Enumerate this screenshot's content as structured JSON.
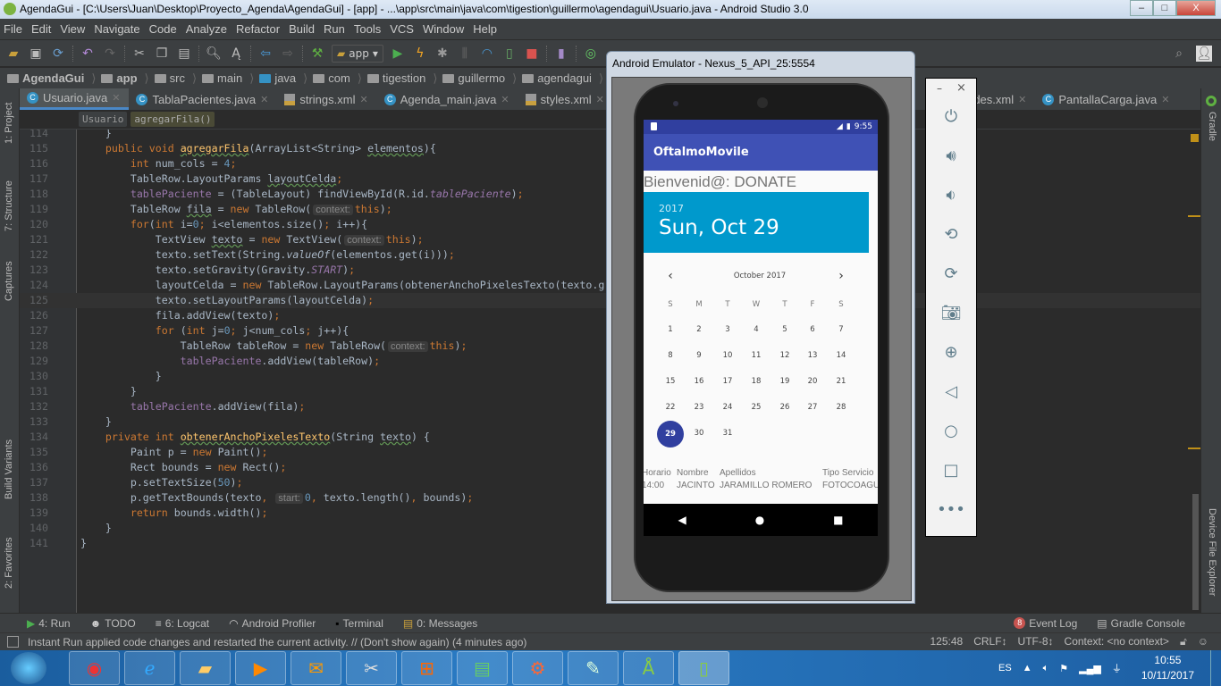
{
  "window": {
    "title": "AgendaGui - [C:\\Users\\Juan\\Desktop\\Proyecto_Agenda\\AgendaGui] - [app] - ...\\app\\src\\main\\java\\com\\tigestion\\guillermo\\agendagui\\Usuario.java - Android Studio 3.0",
    "min": "–",
    "max": "□",
    "close": "X"
  },
  "menu": [
    "File",
    "Edit",
    "View",
    "Navigate",
    "Code",
    "Analyze",
    "Refactor",
    "Build",
    "Run",
    "Tools",
    "VCS",
    "Window",
    "Help"
  ],
  "toolbar": {
    "run_config": "app"
  },
  "breadcrumb": [
    "AgendaGui",
    "app",
    "src",
    "main",
    "java",
    "com",
    "tigestion",
    "guillermo",
    "agendagui",
    "Usuario"
  ],
  "tabs": [
    {
      "label": "Usuario.java",
      "type": "class",
      "active": true
    },
    {
      "label": "TablaPacientes.java",
      "type": "class"
    },
    {
      "label": "strings.xml",
      "type": "xml"
    },
    {
      "label": "Agenda_main.java",
      "type": "class"
    },
    {
      "label": "styles.xml",
      "type": "xml"
    },
    {
      "label": "a",
      "type": "xml"
    }
  ],
  "tabs_right": [
    {
      "label": "rdes.xml",
      "type": "xml"
    },
    {
      "label": "PantallaCarga.java",
      "type": "class"
    }
  ],
  "method_breadcrumb": {
    "class": "Usuario",
    "method": "agregarFila()"
  },
  "left_tools": [
    "1: Project",
    "7: Structure",
    "Captures",
    "Build Variants",
    "2: Favorites"
  ],
  "right_tools": [
    "Gradle",
    "Device File Explorer"
  ],
  "code": [
    {
      "n": 114,
      "t": [
        [
          "p",
          "    }"
        ]
      ]
    },
    {
      "n": 115,
      "t": [
        [
          "p",
          "    "
        ],
        [
          "k",
          "public void "
        ],
        [
          "mw",
          "agregarFila"
        ],
        [
          "p",
          "(ArrayList<String> "
        ],
        [
          "w",
          "elementos"
        ],
        [
          "p",
          "){"
        ]
      ]
    },
    {
      "n": 116,
      "t": [
        [
          "p",
          "        "
        ],
        [
          "k",
          "int "
        ],
        [
          "p",
          "num_cols = "
        ],
        [
          "n",
          "4"
        ],
        [
          "k",
          ";"
        ]
      ]
    },
    {
      "n": 117,
      "t": [
        [
          "p",
          "        TableRow.LayoutParams "
        ],
        [
          "w",
          "layoutCelda"
        ],
        [
          "k",
          ";"
        ]
      ]
    },
    {
      "n": 118,
      "t": [
        [
          "f",
          "        tablePaciente"
        ],
        [
          "p",
          " = (TableLayout) findViewById(R.id."
        ],
        [
          "fi",
          "tablePaciente"
        ],
        [
          "p",
          ")"
        ],
        [
          "k",
          ";"
        ]
      ]
    },
    {
      "n": 119,
      "t": [
        [
          "p",
          "        TableRow "
        ],
        [
          "w",
          "fila"
        ],
        [
          "p",
          " = "
        ],
        [
          "k",
          "new "
        ],
        [
          "p",
          "TableRow("
        ],
        [
          "h",
          "context:"
        ],
        [
          "k",
          "this"
        ],
        [
          "p",
          ")"
        ],
        [
          "k",
          ";"
        ]
      ]
    },
    {
      "n": 120,
      "t": [
        [
          "p",
          "        "
        ],
        [
          "k",
          "for"
        ],
        [
          "p",
          "("
        ],
        [
          "k",
          "int "
        ],
        [
          "p",
          "i="
        ],
        [
          "n",
          "0"
        ],
        [
          "k",
          "; "
        ],
        [
          "p",
          "i<elementos.size()"
        ],
        [
          "k",
          "; "
        ],
        [
          "p",
          "i++){"
        ]
      ]
    },
    {
      "n": 121,
      "t": [
        [
          "p",
          "            TextView "
        ],
        [
          "w",
          "texto"
        ],
        [
          "p",
          " = "
        ],
        [
          "k",
          "new "
        ],
        [
          "p",
          "TextView("
        ],
        [
          "h",
          "context:"
        ],
        [
          "k",
          "this"
        ],
        [
          "p",
          ")"
        ],
        [
          "k",
          ";"
        ]
      ]
    },
    {
      "n": 122,
      "t": [
        [
          "p",
          "            texto.setText(String."
        ],
        [
          "i",
          "valueOf"
        ],
        [
          "p",
          "(elementos.get(i)))"
        ],
        [
          "k",
          ";"
        ]
      ]
    },
    {
      "n": 123,
      "t": [
        [
          "p",
          "            texto.setGravity(Gravity."
        ],
        [
          "fi",
          "START"
        ],
        [
          "p",
          ")"
        ],
        [
          "k",
          ";"
        ]
      ]
    },
    {
      "n": 124,
      "t": [
        [
          "p",
          "            layoutCelda = "
        ],
        [
          "k",
          "new "
        ],
        [
          "p",
          "TableRow.LayoutParams(obtenerAnchoPixelesTexto(texto.g"
        ]
      ]
    },
    {
      "n": 125,
      "t": [
        [
          "p",
          "            texto.setLayoutParams(layoutCelda)"
        ],
        [
          "k",
          ";"
        ]
      ],
      "current": true
    },
    {
      "n": 126,
      "t": [
        [
          "p",
          "            fila.addView(texto)"
        ],
        [
          "k",
          ";"
        ]
      ]
    },
    {
      "n": 127,
      "t": [
        [
          "p",
          "            "
        ],
        [
          "k",
          "for "
        ],
        [
          "p",
          "("
        ],
        [
          "k",
          "int "
        ],
        [
          "p",
          "j="
        ],
        [
          "n",
          "0"
        ],
        [
          "k",
          "; "
        ],
        [
          "p",
          "j<num_cols"
        ],
        [
          "k",
          "; "
        ],
        [
          "p",
          "j++){"
        ]
      ]
    },
    {
      "n": 128,
      "t": [
        [
          "p",
          "                TableRow tableRow = "
        ],
        [
          "k",
          "new "
        ],
        [
          "p",
          "TableRow("
        ],
        [
          "h",
          "context:"
        ],
        [
          "k",
          "this"
        ],
        [
          "p",
          ")"
        ],
        [
          "k",
          ";"
        ]
      ]
    },
    {
      "n": 129,
      "t": [
        [
          "f",
          "                tablePaciente"
        ],
        [
          "p",
          ".addView(tableRow)"
        ],
        [
          "k",
          ";"
        ]
      ]
    },
    {
      "n": 130,
      "t": [
        [
          "p",
          "            }"
        ]
      ]
    },
    {
      "n": 131,
      "t": [
        [
          "p",
          "        }"
        ]
      ]
    },
    {
      "n": 132,
      "t": [
        [
          "f",
          "        tablePaciente"
        ],
        [
          "p",
          ".addView(fila)"
        ],
        [
          "k",
          ";"
        ]
      ]
    },
    {
      "n": 133,
      "t": [
        [
          "p",
          "    }"
        ]
      ]
    },
    {
      "n": 134,
      "t": [
        [
          "p",
          "    "
        ],
        [
          "k",
          "private int "
        ],
        [
          "mw",
          "obtenerAnchoPixelesTexto"
        ],
        [
          "p",
          "(String "
        ],
        [
          "w",
          "texto"
        ],
        [
          "p",
          ") {"
        ]
      ]
    },
    {
      "n": 135,
      "t": [
        [
          "p",
          "        Paint p = "
        ],
        [
          "k",
          "new "
        ],
        [
          "p",
          "Paint()"
        ],
        [
          "k",
          ";"
        ]
      ]
    },
    {
      "n": 136,
      "t": [
        [
          "p",
          "        Rect bounds = "
        ],
        [
          "k",
          "new "
        ],
        [
          "p",
          "Rect()"
        ],
        [
          "k",
          ";"
        ]
      ]
    },
    {
      "n": 137,
      "t": [
        [
          "p",
          "        p.setTextSize("
        ],
        [
          "n",
          "50"
        ],
        [
          "p",
          ")"
        ],
        [
          "k",
          ";"
        ]
      ]
    },
    {
      "n": 138,
      "t": [
        [
          "p",
          "        p.getTextBounds(texto"
        ],
        [
          "k",
          ", "
        ],
        [
          "h",
          "start:"
        ],
        [
          "n",
          "0"
        ],
        [
          "k",
          ", "
        ],
        [
          "p",
          "texto.length()"
        ],
        [
          "k",
          ", "
        ],
        [
          "p",
          "bounds)"
        ],
        [
          "k",
          ";"
        ]
      ]
    },
    {
      "n": 139,
      "t": [
        [
          "p",
          "        "
        ],
        [
          "k",
          "return "
        ],
        [
          "p",
          "bounds.width()"
        ],
        [
          "k",
          ";"
        ]
      ]
    },
    {
      "n": 140,
      "t": [
        [
          "p",
          "    }"
        ]
      ]
    },
    {
      "n": 141,
      "t": [
        [
          "p",
          "}"
        ]
      ]
    }
  ],
  "bottom_tools": [
    {
      "label": "4: Run",
      "icon": "run-icon"
    },
    {
      "label": "TODO",
      "icon": "todo-icon"
    },
    {
      "label": "6: Logcat",
      "icon": "logcat-icon"
    },
    {
      "label": "Android Profiler",
      "icon": "profiler-icon"
    },
    {
      "label": "Terminal",
      "icon": "terminal-icon"
    },
    {
      "label": "0: Messages",
      "icon": "messages-icon"
    }
  ],
  "event_log": {
    "count": "8",
    "label": "Event Log"
  },
  "gradle_console": "Gradle Console",
  "status": {
    "message": "Instant Run applied code changes and restarted the current activity. // (Don't show again) (4 minutes ago)",
    "position": "125:48",
    "line_sep": "CRLF↕",
    "encoding": "UTF-8↕",
    "context": "Context: <no context>"
  },
  "emulator": {
    "title": "Android Emulator - Nexus_5_API_25:5554",
    "time": "9:55",
    "app_title": "OftalmoMovile",
    "welcome": "Bienvenid@: DONATE",
    "year": "2017",
    "date": "Sun, Oct 29",
    "month": "October 2017",
    "dow": [
      "S",
      "M",
      "T",
      "W",
      "T",
      "F",
      "S"
    ],
    "weeks": [
      [
        "1",
        "2",
        "3",
        "4",
        "5",
        "6",
        "7"
      ],
      [
        "8",
        "9",
        "10",
        "11",
        "12",
        "13",
        "14"
      ],
      [
        "15",
        "16",
        "17",
        "18",
        "19",
        "20",
        "21"
      ],
      [
        "22",
        "23",
        "24",
        "25",
        "26",
        "27",
        "28"
      ],
      [
        "29",
        "30",
        "31"
      ]
    ],
    "selected_day": "29",
    "table_headers": [
      "Horario",
      "Nombre",
      "Apellidos",
      "Tipo Servicio"
    ],
    "table_row": [
      "14:00",
      "JACINTO",
      "JARAMILLO ROMERO",
      "FOTOCOAGU"
    ],
    "accent": "#0099cc",
    "primary": "#3f51b5"
  },
  "emulator_controls": {
    "min": "–",
    "close": "×",
    "buttons": [
      "power-icon",
      "volume-up-icon",
      "volume-down-icon",
      "rotate-left-icon",
      "rotate-right-icon",
      "camera-icon",
      "zoom-icon",
      "back-icon",
      "home-icon",
      "overview-icon",
      "more-icon"
    ]
  },
  "taskbar": {
    "lang": "ES",
    "time": "10:55",
    "date": "10/11/2017"
  }
}
